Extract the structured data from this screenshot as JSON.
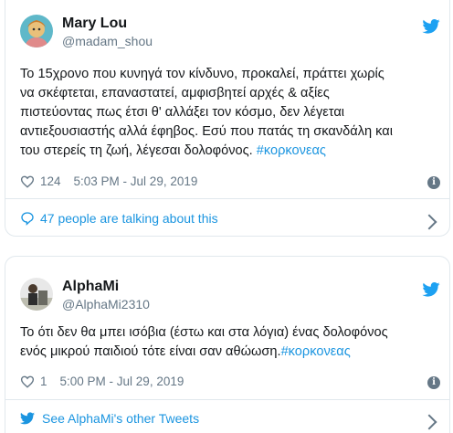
{
  "tweets": [
    {
      "name": "Mary Lou",
      "handle": "@madam_shou",
      "text_main": "Το 15χρονο που κυνηγά τον κίνδυνο, προκαλεί, πράττει χωρίς\nνα σκέφτεται, επαναστατεί, αμφισβητεί αρχές & αξίες\nπιστεύοντας πως έτσι θ' αλλάξει τον κόσμο, δεν λέγεται\nαντιεξουσιαστής αλλά έφηβος. Εσύ που πατάς τη σκανδάλη και\nτου στερείς τη ζωή, λέγεσαι δολοφόνος. ",
      "hashtag": "#κορκονεας",
      "likes": "124",
      "time": "5:03 PM - Jul 29, 2019",
      "footer": "47 people are talking about this"
    },
    {
      "name": "AlphaMi",
      "handle": "@AlphaMi2310",
      "text_main": "Το ότι δεν θα μπει ισόβια (έστω και στα λόγια) ένας δολοφόνος\nενός μικρού παιδιού τότε είναι σαν αθώωση.",
      "hashtag": "#κορκονεας",
      "likes": "1",
      "time": "5:00 PM - Jul 29, 2019",
      "footer": "See AlphaMi's other Tweets"
    }
  ],
  "colors": {
    "link": "#1b95e0",
    "muted": "#657786",
    "border": "#e1e8ed",
    "twitter": "#1da1f2"
  },
  "icons": [
    "twitter-bird-icon",
    "heart-icon",
    "info-icon",
    "comment-icon",
    "chevron-right-icon"
  ]
}
